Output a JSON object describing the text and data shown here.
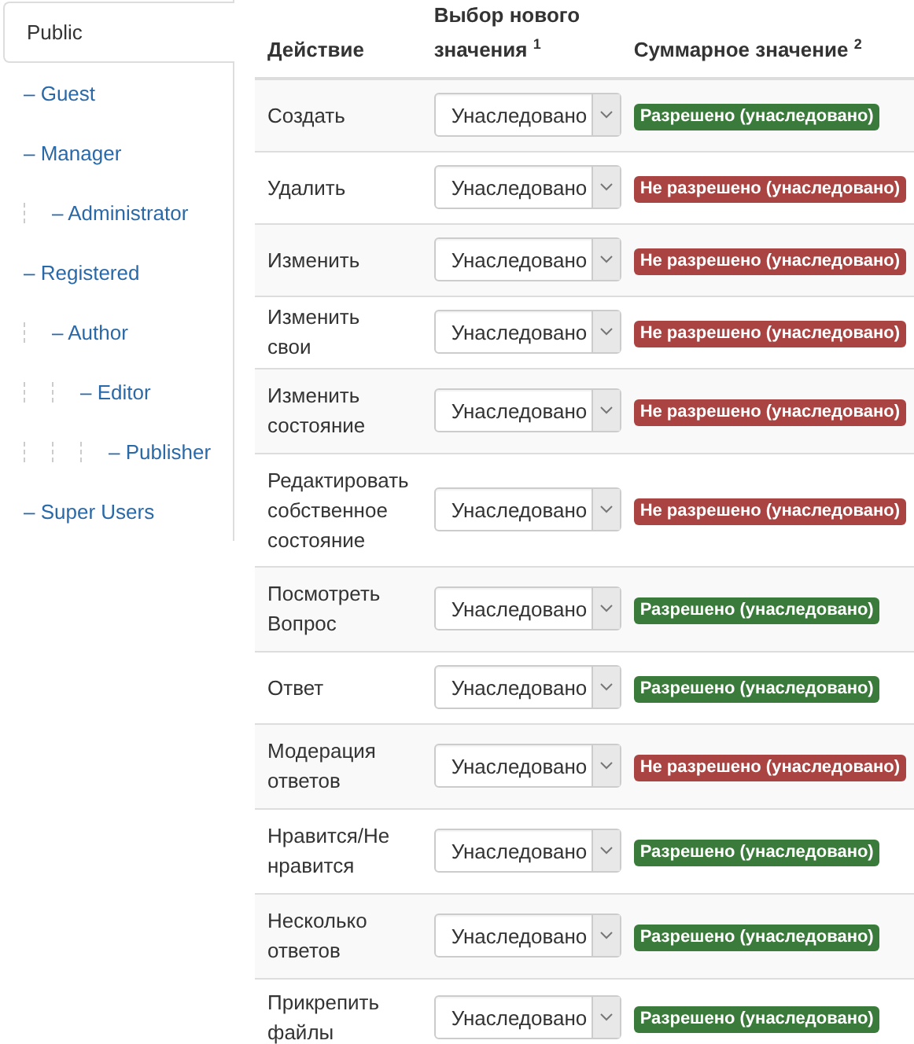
{
  "groups": [
    {
      "label": "Public",
      "selected": true,
      "children": [
        {
          "label": "– Guest",
          "selected": false
        },
        {
          "label": "– Manager",
          "selected": false,
          "children": [
            {
              "label": "– Administrator",
              "selected": false
            }
          ]
        },
        {
          "label": "– Registered",
          "selected": false,
          "children": [
            {
              "label": "– Author",
              "selected": false,
              "children": [
                {
                  "label": "– Editor",
                  "selected": false,
                  "children": [
                    {
                      "label": "– Publisher",
                      "selected": false
                    }
                  ]
                }
              ]
            }
          ]
        },
        {
          "label": "– Super Users",
          "selected": false
        }
      ]
    }
  ],
  "table": {
    "columns": [
      "Действие",
      "Выбор нового значения $^{1}$",
      "Суммарное значение $^{2}$"
    ],
    "rows": [
      {
        "action": "Создать",
        "setting": "Унаследовано",
        "result": "Разрешено (унаследовано)",
        "allowed": true
      },
      {
        "action": "Удалить",
        "setting": "Унаследовано",
        "result": "Не разрешено (унаследовано)",
        "allowed": false
      },
      {
        "action": "Изменить",
        "setting": "Унаследовано",
        "result": "Не разрешено (унаследовано)",
        "allowed": false
      },
      {
        "action": "Изменить свои",
        "setting": "Унаследовано",
        "result": "Не разрешено (унаследовано)",
        "allowed": false
      },
      {
        "action": "Изменить состояние",
        "setting": "Унаследовано",
        "result": "Не разрешено (унаследовано)",
        "allowed": false
      },
      {
        "action": "Редактировать собственное состояние",
        "setting": "Унаследовано",
        "result": "Не разрешено (унаследовано)",
        "allowed": false
      },
      {
        "action": "Посмотреть Вопрос",
        "setting": "Унаследовано",
        "result": "Разрешено (унаследовано)",
        "allowed": true
      },
      {
        "action": "Ответ",
        "setting": "Унаследовано",
        "result": "Разрешено (унаследовано)",
        "allowed": true
      },
      {
        "action": "Модерация ответов",
        "setting": "Унаследовано",
        "result": "Не разрешено (унаследовано)",
        "allowed": false
      },
      {
        "action": "Нравится/Не нравится",
        "setting": "Унаследовано",
        "result": "Разрешено (унаследовано)",
        "allowed": true
      },
      {
        "action": "Несколько ответов",
        "setting": "Унаследовано",
        "result": "Разрешено (унаследовано)",
        "allowed": true
      },
      {
        "action": "Прикрепить файлы",
        "setting": "Унаследовано",
        "result": "Разрешено (унаследовано)",
        "allowed": true
      }
    ]
  }
}
